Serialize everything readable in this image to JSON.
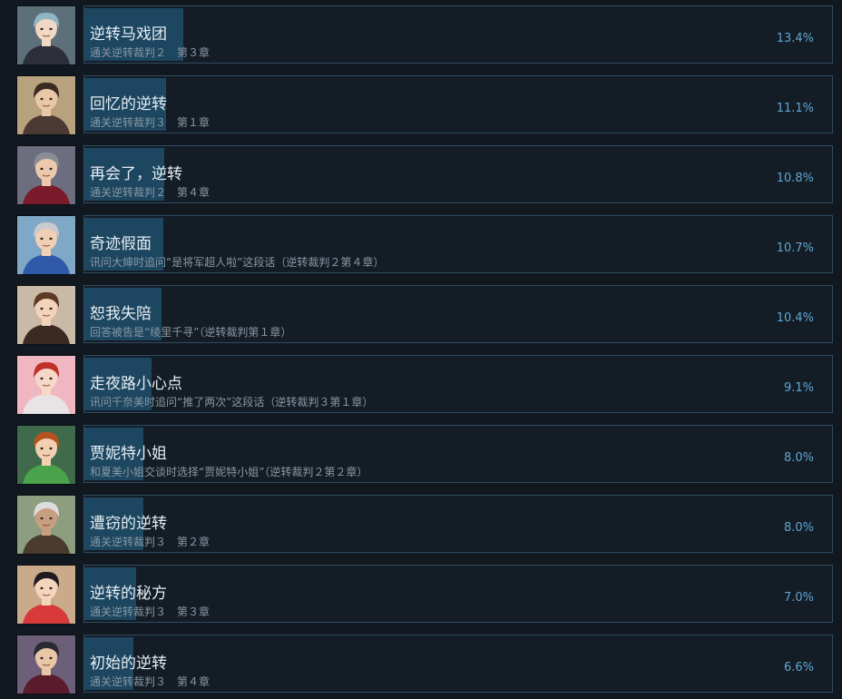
{
  "achievements": [
    {
      "title": "逆转马戏团",
      "description": "通关逆转裁判２　第３章",
      "percent": "13.4%",
      "icon": "portrait-franziska-icon",
      "colors": {
        "bg": "#5d6f78",
        "hair": "#8fb6c4",
        "skin": "#f1d8c4",
        "cloth": "#2c2f3a"
      }
    },
    {
      "title": "回忆的逆转",
      "description": "通关逆转裁判３　第１章",
      "percent": "11.1%",
      "icon": "portrait-mia-dahlia-icon",
      "colors": {
        "bg": "#b7a27d",
        "hair": "#3a2a22",
        "skin": "#e9c8a8",
        "cloth": "#4b3a33"
      }
    },
    {
      "title": "再会了，逆转",
      "description": "通关逆转裁判２　第４章",
      "percent": "10.8%",
      "icon": "portrait-edgeworth-icon",
      "colors": {
        "bg": "#6c6d7f",
        "hair": "#8b8d96",
        "skin": "#ecc9ad",
        "cloth": "#7b1a2a"
      }
    },
    {
      "title": "奇迹假面",
      "description": "讯问大婶时追问“是将军超人啦”这段话（逆转裁判２第４章）",
      "percent": "10.7%",
      "icon": "portrait-oldbag-icon",
      "colors": {
        "bg": "#7fa7c6",
        "hair": "#c9c9cf",
        "skin": "#f0cfb4",
        "cloth": "#2f5aa8"
      }
    },
    {
      "title": "恕我失陪",
      "description": "回答被告是“绫里千寻”（逆转裁判第１章）",
      "percent": "10.4%",
      "icon": "portrait-mia-icon",
      "colors": {
        "bg": "#c9b9a6",
        "hair": "#5b3a24",
        "skin": "#f2d2b8",
        "cloth": "#3b2a22"
      }
    },
    {
      "title": "走夜路小心点",
      "description": "讯问千奈美时追问“推了两次”这段话（逆转裁判３第１章）",
      "percent": "9.1%",
      "icon": "portrait-dahlia-icon",
      "colors": {
        "bg": "#f0b7c2",
        "hair": "#c2302a",
        "skin": "#f6d7c8",
        "cloth": "#e8e4e6"
      }
    },
    {
      "title": "贾妮特小姐",
      "description": "和夏美小姐交谈时选择“贾妮特小姐”（逆转裁判２第２章）",
      "percent": "8.0%",
      "icon": "portrait-lotta-icon",
      "colors": {
        "bg": "#3f6b4c",
        "hair": "#b5531f",
        "skin": "#f1cfb0",
        "cloth": "#4aa34a"
      }
    },
    {
      "title": "遭窃的逆转",
      "description": "通关逆转裁判３　第２章",
      "percent": "8.0%",
      "icon": "portrait-godot-icon",
      "colors": {
        "bg": "#8d9d80",
        "hair": "#dcdcdc",
        "skin": "#c79f80",
        "cloth": "#4a3b2c"
      }
    },
    {
      "title": "逆转的秘方",
      "description": "通关逆转裁判３　第３章",
      "percent": "7.0%",
      "icon": "portrait-maya-icon",
      "colors": {
        "bg": "#c9aa8a",
        "hair": "#1e1a20",
        "skin": "#f3d5bb",
        "cloth": "#d83a3a"
      }
    },
    {
      "title": "初始的逆转",
      "description": "通关逆转裁判３　第４章",
      "percent": "6.6%",
      "icon": "portrait-godot-redd-icon",
      "colors": {
        "bg": "#6d5f7a",
        "hair": "#2a2a33",
        "skin": "#e8c6a6",
        "cloth": "#5a1c2c"
      }
    }
  ]
}
